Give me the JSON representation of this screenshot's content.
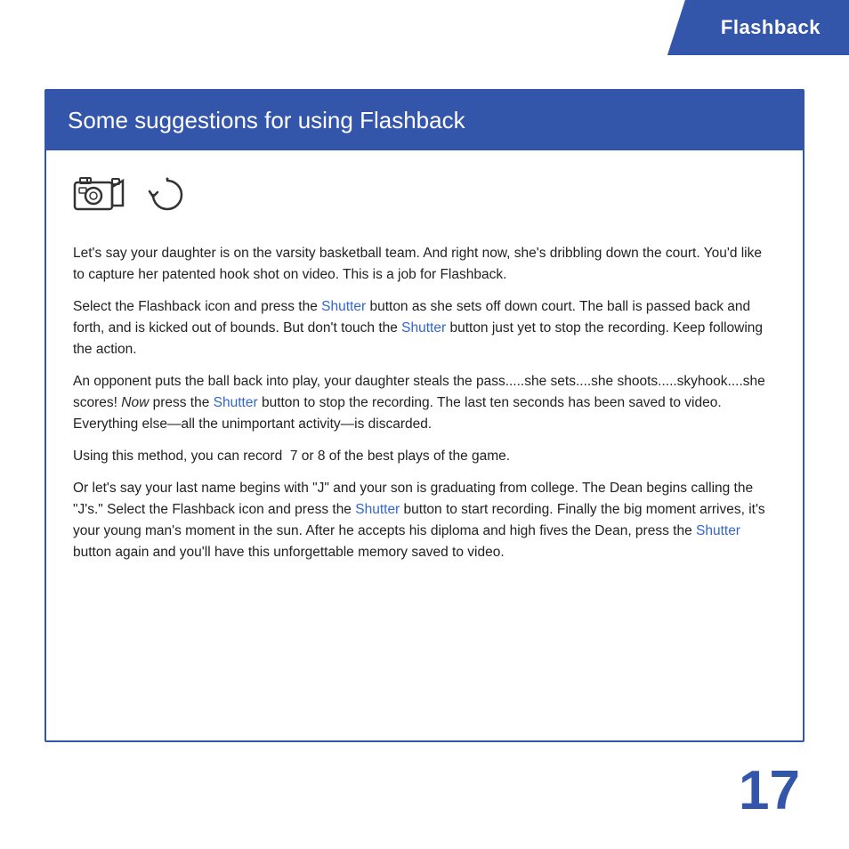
{
  "header": {
    "title": "Flashback",
    "bg_color": "#3355aa"
  },
  "main_box": {
    "title": "Some suggestions for using Flashback",
    "paragraphs": [
      {
        "id": "p1",
        "text": "Let’s say your daughter is on the varsity basketball team. And right now, she’s dribbling down the court. You’d like to capture her patented hook shot on video. This is a job for Flashback."
      },
      {
        "id": "p2",
        "parts": [
          {
            "type": "text",
            "content": "Select the Flashback icon and press the "
          },
          {
            "type": "link",
            "content": "Shutter"
          },
          {
            "type": "text",
            "content": " button as she sets off down court. The ball is passed back and forth, and is kicked out of bounds. But don’t touch the "
          },
          {
            "type": "link",
            "content": "Shutter"
          },
          {
            "type": "text",
            "content": " button just yet to stop the recording. Keep following the action."
          }
        ]
      },
      {
        "id": "p3",
        "parts": [
          {
            "type": "text",
            "content": "An opponent puts the ball back into play, your daughter steals the pass.....she sets....she shoots.....skyhook....she scores! "
          },
          {
            "type": "italic",
            "content": "Now"
          },
          {
            "type": "text",
            "content": " press the "
          },
          {
            "type": "link",
            "content": "Shutter"
          },
          {
            "type": "text",
            "content": " button to stop the recording. The last ten seconds has been saved to video. Everything else—all the unimportant activity—is discarded."
          }
        ]
      },
      {
        "id": "p4",
        "text": "Using this method, you can record  7 or 8 of the best plays of the game."
      },
      {
        "id": "p5",
        "parts": [
          {
            "type": "text",
            "content": "Or let’s say your last name begins with “J” and your son is graduating from college. The Dean begins calling the “J’s.” Select the Flashback icon and press the "
          },
          {
            "type": "link",
            "content": "Shutter"
          },
          {
            "type": "text",
            "content": " button to start recording. Finally the big moment arrives, it’s your young man’s moment in the sun. After he accepts his diploma and high fives the Dean, press the "
          },
          {
            "type": "link",
            "content": "Shutter"
          },
          {
            "type": "text",
            "content": " button again and you’ll have this unforgettable memory saved to video."
          }
        ]
      }
    ]
  },
  "page_number": "17",
  "shutter_color": "#3366cc"
}
